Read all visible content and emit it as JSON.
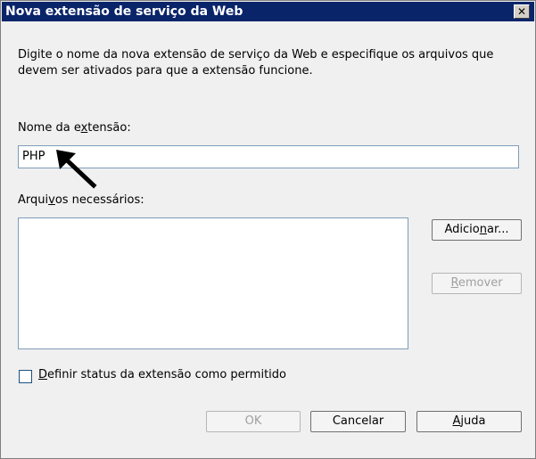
{
  "window": {
    "title": "Nova extensão de serviço da Web",
    "close_label": "✕"
  },
  "description": "Digite o nome da nova extensão de serviço da Web e especifique os arquivos que devem ser ativados para que a extensão funcione.",
  "extension_name": {
    "label_pre": "Nome da e",
    "label_accel": "x",
    "label_post": "tensão:",
    "value": "PHP"
  },
  "files": {
    "label_pre": "Arqui",
    "label_accel": "v",
    "label_post": "os necessários:",
    "items": []
  },
  "buttons": {
    "add": {
      "pre": "Adicio",
      "accel": "n",
      "post": "ar..."
    },
    "remove": {
      "pre": "",
      "accel": "R",
      "post": "emover"
    },
    "ok": "OK",
    "cancel": "Cancelar",
    "help": {
      "pre": "",
      "accel": "A",
      "post": "juda"
    }
  },
  "checkbox": {
    "pre": "",
    "accel": "D",
    "post": "efinir status da extensão como permitido",
    "checked": false
  }
}
